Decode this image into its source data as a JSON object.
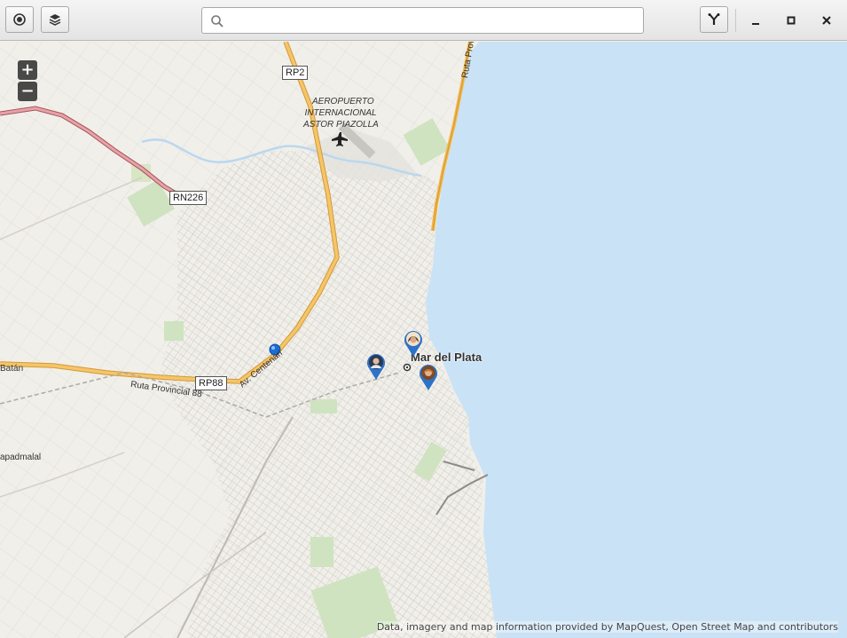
{
  "header": {
    "locate_icon": "crosshair-icon",
    "layers_icon": "layers-icon",
    "search_placeholder": "",
    "search_value": "",
    "share_icon": "share-icon",
    "minimize_icon": "minimize-icon",
    "maximize_icon": "maximize-icon",
    "close_icon": "close-icon"
  },
  "map": {
    "zoom_in": "+",
    "zoom_out": "−",
    "road_labels": [
      "RP2",
      "RN226",
      "RP88"
    ],
    "airport_line1": "AEROPUERTO",
    "airport_line2": "INTERNACIONAL",
    "airport_line3": "ASTOR PIAZOLLA",
    "city": "Mar del Plata",
    "road_ruta_provincial_88": "Ruta Provincial 88",
    "road_av_centenario": "Av. Centenari",
    "road_ruta_provincial": "Ruta Provincial",
    "place_batan": "Batán",
    "place_chapadmalal": "apadmalal",
    "attribution": "Data, imagery and map information provided by MapQuest, Open Street Map and contributors",
    "water_color": "#c9e2f6",
    "land_color": "#f1efe9",
    "main_road_color": "#f2b64b"
  }
}
